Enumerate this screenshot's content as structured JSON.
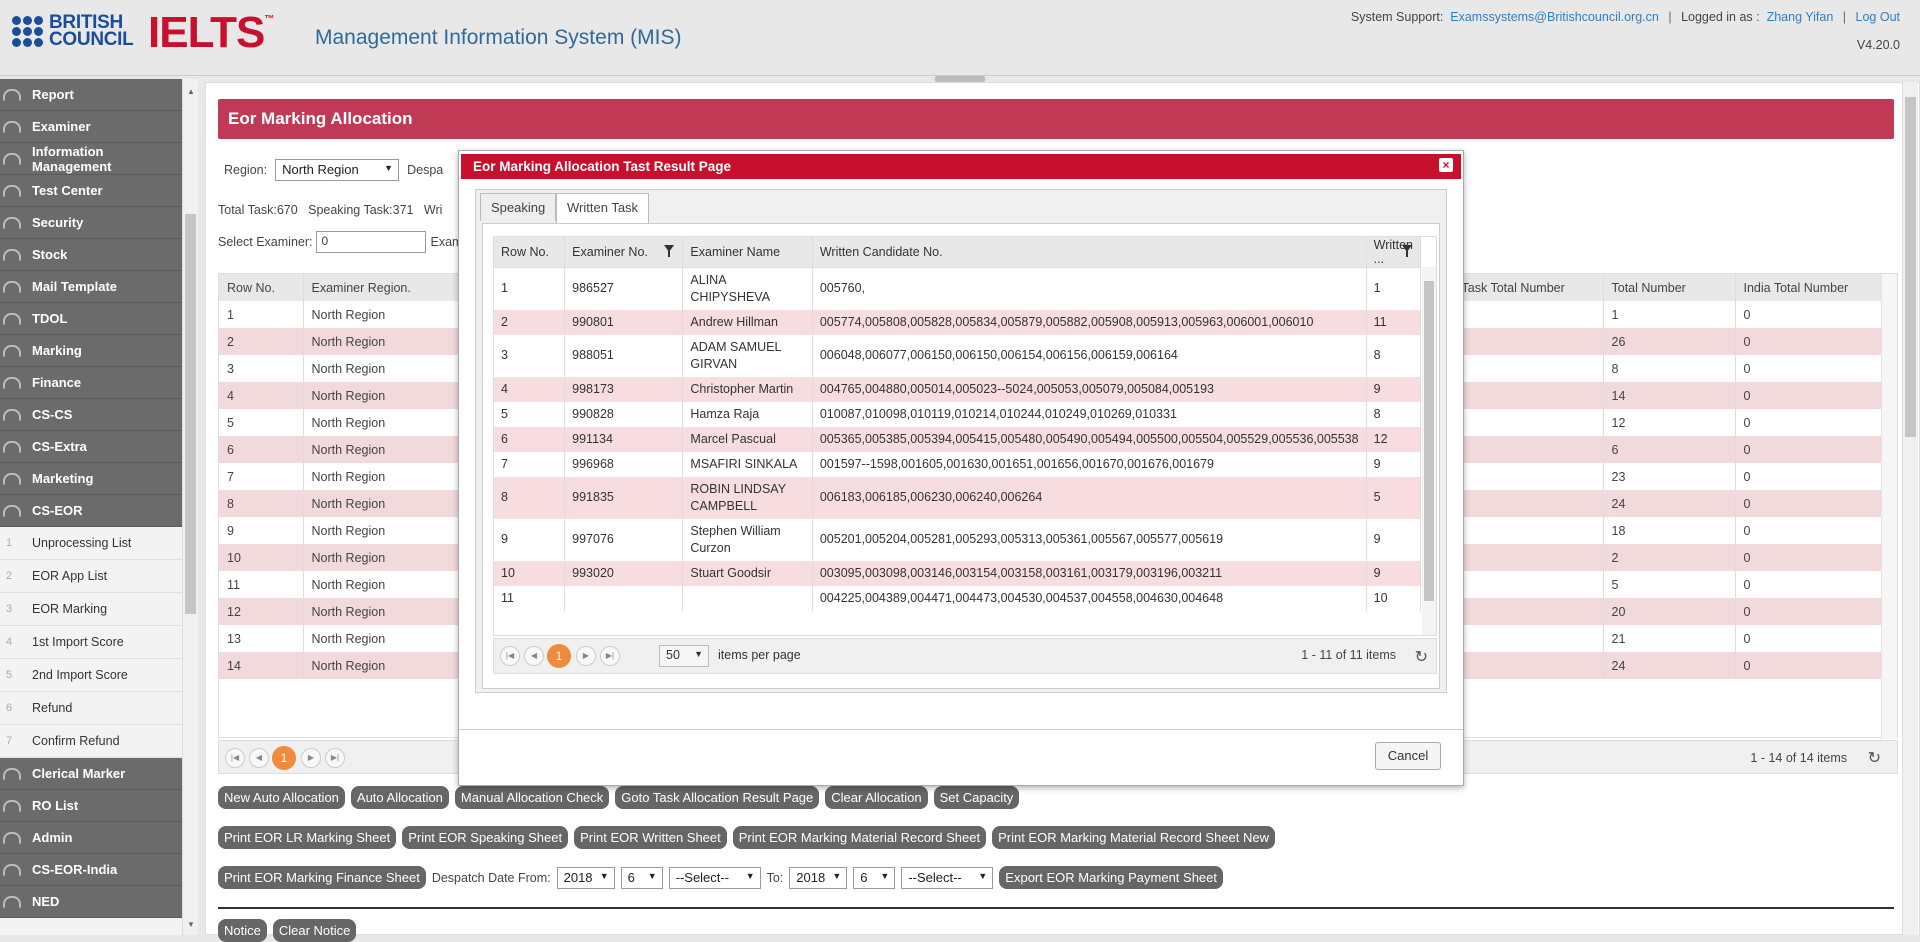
{
  "header": {
    "brand_top": "BRITISH",
    "brand_bottom": "COUNCIL",
    "ielts": "IELTS",
    "ielts_tm": "™",
    "system_title": "Management Information System (MIS)",
    "support_label": "System Support:",
    "support_email": "Examssystems@Britishcouncil.org.cn",
    "logged_label": "Logged in as :",
    "user": "Zhang Yifan",
    "logout": "Log Out",
    "version": "V4.20.0"
  },
  "sidebar": {
    "top_items": [
      "Report",
      "Examiner",
      "Information Management",
      "Test Center",
      "Security",
      "Stock",
      "Mail Template",
      "TDOL",
      "Marking",
      "Finance",
      "CS-CS",
      "CS-Extra",
      "Marketing",
      "CS-EOR"
    ],
    "sub_items": [
      {
        "num": "1",
        "label": "Unprocessing List"
      },
      {
        "num": "2",
        "label": "EOR App List"
      },
      {
        "num": "3",
        "label": "EOR Marking"
      },
      {
        "num": "4",
        "label": "1st Import Score"
      },
      {
        "num": "5",
        "label": "2nd Import Score"
      },
      {
        "num": "6",
        "label": "Refund"
      },
      {
        "num": "7",
        "label": "Confirm Refund"
      }
    ],
    "bottom_items": [
      "Clerical Marker",
      "RO List",
      "Admin",
      "CS-EOR-India",
      "NED"
    ]
  },
  "main": {
    "banner": "Eor Marking Allocation",
    "region_label": "Region:",
    "region_value": "North Region",
    "despatch_label": "Despa",
    "stats": "Total Task:670   Speaking Task:371   Wri",
    "select_examiner_label": "Select Examiner:",
    "select_examiner_value": "0",
    "exam_label": "Exam",
    "grid": {
      "headers": [
        "Row No.",
        "Examiner Region.",
        "Task Total Number",
        "Total Number",
        "India Total Number"
      ],
      "rows": [
        [
          "1",
          "North Region",
          "",
          "1",
          "0"
        ],
        [
          "2",
          "North Region",
          "",
          "26",
          "0"
        ],
        [
          "3",
          "North Region",
          "",
          "8",
          "0"
        ],
        [
          "4",
          "North Region",
          "",
          "14",
          "0"
        ],
        [
          "5",
          "North Region",
          "",
          "12",
          "0"
        ],
        [
          "6",
          "North Region",
          "",
          "6",
          "0"
        ],
        [
          "7",
          "North Region",
          "",
          "23",
          "0"
        ],
        [
          "8",
          "North Region",
          "",
          "24",
          "0"
        ],
        [
          "9",
          "North Region",
          "",
          "18",
          "0"
        ],
        [
          "10",
          "North Region",
          "",
          "2",
          "0"
        ],
        [
          "11",
          "North Region",
          "",
          "5",
          "0"
        ],
        [
          "12",
          "North Region",
          "",
          "20",
          "0"
        ],
        [
          "13",
          "North Region",
          "",
          "21",
          "0"
        ],
        [
          "14",
          "North Region",
          "",
          "24",
          "0"
        ]
      ],
      "page": "1",
      "info": "1 - 14 of 14 items"
    },
    "buttons_row1": [
      "New Auto Allocation",
      "Auto Allocation",
      "Manual Allocation Check",
      "Goto Task Allocation Result Page",
      "Clear Allocation",
      "Set Capacity"
    ],
    "buttons_row2": [
      "Print EOR LR Marking Sheet",
      "Print EOR Speaking Sheet",
      "Print EOR Written Sheet",
      "Print EOR Marking Material Record Sheet",
      "Print EOR Marking Material Record Sheet New"
    ],
    "row3": {
      "print_finance": "Print EOR Marking Finance Sheet",
      "from_label": "Despatch Date From:",
      "from_year": "2018",
      "from_month": "6",
      "from_day": "--Select--",
      "to_label": "To:",
      "to_year": "2018",
      "to_month": "6",
      "to_day": "--Select--",
      "export": "Export EOR Marking Payment Sheet"
    },
    "notice": "Notice",
    "clear_notice": "Clear Notice"
  },
  "dialog": {
    "title": "Eor Marking Allocation Tast Result Page",
    "close": "×",
    "tabs": [
      "Speaking",
      "Written Task"
    ],
    "headers": [
      "Row No.",
      "Examiner No.",
      "Examiner Name",
      "Written Candidate No.",
      "Written ..."
    ],
    "rows": [
      [
        "1",
        "986527",
        "ALINA CHIPYSHEVA",
        "005760,",
        "1"
      ],
      [
        "2",
        "990801",
        "Andrew Hillman",
        "005774,005808,005828,005834,005879,005882,005908,005913,005963,006001,006010",
        "11"
      ],
      [
        "3",
        "988051",
        "ADAM SAMUEL GIRVAN",
        "006048,006077,006150,006150,006154,006156,006159,006164",
        "8"
      ],
      [
        "4",
        "998173",
        "Christopher Martin",
        "004765,004880,005014,005023--5024,005053,005079,005084,005193",
        "9"
      ],
      [
        "5",
        "990828",
        "Hamza Raja",
        "010087,010098,010119,010214,010244,010249,010269,010331",
        "8"
      ],
      [
        "6",
        "991134",
        "Marcel Pascual",
        "005365,005385,005394,005415,005480,005490,005494,005500,005504,005529,005536,005538",
        "12"
      ],
      [
        "7",
        "996968",
        "MSAFIRI SINKALA",
        "001597--1598,001605,001630,001651,001656,001670,001676,001679",
        "9"
      ],
      [
        "8",
        "991835",
        "ROBIN LINDSAY CAMPBELL",
        "006183,006185,006230,006240,006264",
        "5"
      ],
      [
        "9",
        "997076",
        "Stephen William Curzon",
        "005201,005204,005281,005293,005313,005361,005567,005577,005619",
        "9"
      ],
      [
        "10",
        "993020",
        "Stuart Goodsir",
        "003095,003098,003146,003154,003158,003161,003179,003196,003211",
        "9"
      ],
      [
        "11",
        "",
        "",
        "004225,004389,004471,004473,004530,004537,004558,004630,004648",
        "10"
      ]
    ],
    "page": "1",
    "page_size": "50",
    "items_per_page": "items per page",
    "info": "1 - 11 of 11 items",
    "cancel": "Cancel"
  }
}
